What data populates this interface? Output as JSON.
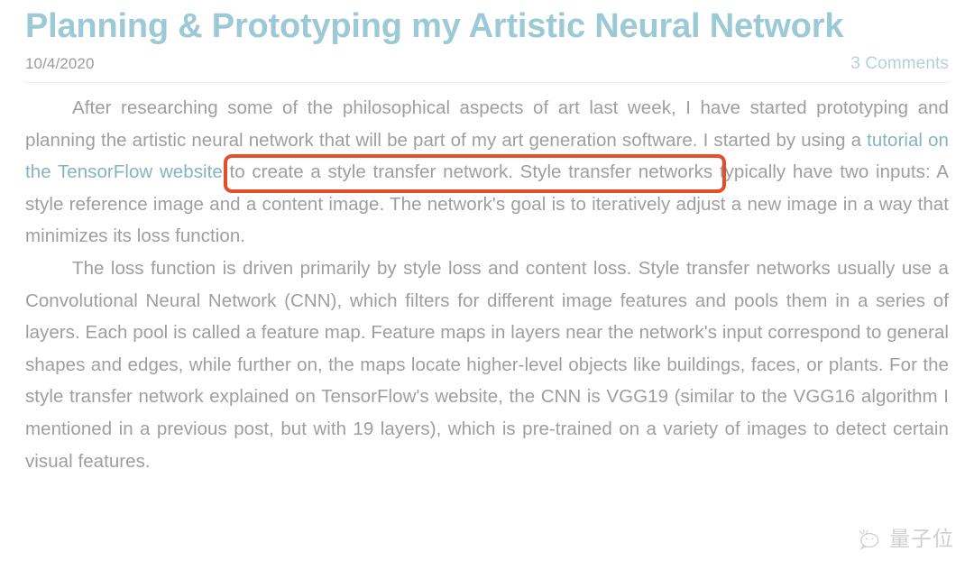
{
  "post": {
    "title": "Planning & Prototyping my Artistic Neural Network",
    "date": "10/4/2020",
    "comments_label": "3 Comments",
    "paragraph_1": {
      "before_link": "After researching some of the philosophical aspects of art last week, I have started prototyping and planning the artistic neural network that will be part of my art generation software. I started by using a ",
      "link_text": "tutorial on the TensorFlow website",
      "after_link": " to create a style transfer network. Style transfer networks typically have two inputs: A style reference image and a content image. The network's goal is to iteratively adjust a new image in a way that minimizes its loss function."
    },
    "paragraph_2": "The loss function is driven primarily by style loss and content loss. Style transfer networks usually use a Convolutional Neural Network (CNN), which filters for different image features and pools them in a series of layers. Each pool is called a feature map. Feature maps in layers near the network's input correspond to general shapes and edges, while further on, the maps locate higher-level objects like buildings, faces, or plants. For the style transfer network explained on TensorFlow's website, the CNN is VGG19 (similar to the VGG16 algorithm I mentioned in a previous post, but with 19 layers), which is pre-trained on a variety of images to detect certain visual features."
  },
  "annotation": {
    "type": "rectangle-highlight",
    "color": "#e2502a",
    "target_text": "by using a tutorial on the TensorFlow website to create a"
  },
  "watermark": {
    "icon_name": "speech-bubble-smiley-icon",
    "text": "量子位"
  },
  "colors": {
    "title": "#9cc9d6",
    "body_text": "#9e9e9e",
    "link": "#86b3c0",
    "comments": "#b7d0d9",
    "date": "#9b9b9b",
    "annotation": "#e2502a",
    "divider": "#e9e9e9",
    "background": "#ffffff"
  }
}
